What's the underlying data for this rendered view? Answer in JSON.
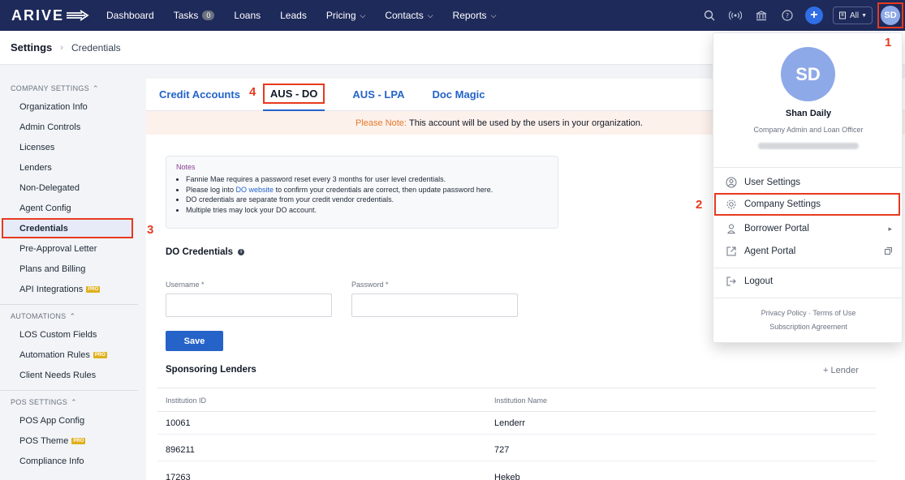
{
  "app": {
    "logo": "ARIVE"
  },
  "nav": {
    "items": [
      {
        "label": "Dashboard"
      },
      {
        "label": "Tasks",
        "badge": "0"
      },
      {
        "label": "Loans"
      },
      {
        "label": "Leads"
      },
      {
        "label": "Pricing",
        "chevron": true
      },
      {
        "label": "Contacts",
        "chevron": true
      },
      {
        "label": "Reports",
        "chevron": true
      }
    ],
    "all_label": "All",
    "avatar_initials": "SD"
  },
  "breadcrumb": {
    "root": "Settings",
    "current": "Credentials"
  },
  "sidebar": {
    "groups": [
      {
        "title": "COMPANY SETTINGS",
        "items": [
          "Organization Info",
          "Admin Controls",
          "Licenses",
          "Lenders",
          "Non-Delegated",
          "Agent Config",
          "Credentials",
          "Pre-Approval Letter",
          "Plans and Billing",
          "API Integrations"
        ]
      },
      {
        "title": "AUTOMATIONS",
        "items": [
          "LOS Custom Fields",
          "Automation Rules",
          "Client Needs Rules"
        ]
      },
      {
        "title": "POS SETTINGS",
        "items": [
          "POS App Config",
          "POS Theme",
          "Compliance Info"
        ]
      }
    ],
    "pro_label": "PRO",
    "active_item": "Credentials"
  },
  "tabs": [
    "Credit Accounts",
    "AUS - DO",
    "AUS - LPA",
    "Doc Magic"
  ],
  "active_tab": "AUS - DO",
  "please_note": {
    "label": "Please Note:",
    "text": "This account will be used by the users in your organization."
  },
  "notes": {
    "title": "Notes",
    "items": [
      {
        "text": "Fannie Mae requires a password reset every 3 months for user level credentials."
      },
      {
        "pre": "Please log into ",
        "link": "DO website",
        "post": " to confirm your credentials are correct, then update password here."
      },
      {
        "text": "DO credentials are separate from your credit vendor credentials."
      },
      {
        "text": "Multiple tries may lock your DO account."
      }
    ]
  },
  "do_credentials": {
    "title": "DO Credentials",
    "username_label": "Username *",
    "password_label": "Password *",
    "username_value": "",
    "password_value": "",
    "save_label": "Save"
  },
  "sponsoring_lenders": {
    "title": "Sponsoring Lenders",
    "add_label": "+ Lender",
    "columns": [
      "Institution ID",
      "Institution Name"
    ],
    "rows": [
      [
        "10061",
        "Lenderr"
      ],
      [
        "896211",
        "727"
      ],
      [
        "17263",
        "Hekeb"
      ]
    ]
  },
  "user_menu": {
    "initials": "SD",
    "name": "Shan Daily",
    "role": "Company Admin and Loan Officer",
    "items": [
      "User Settings",
      "Company Settings",
      "Borrower Portal",
      "Agent Portal",
      "Logout"
    ],
    "footer_line1": "Privacy Policy · Terms of Use",
    "footer_line2": "Subscription Agreement"
  },
  "annotations": [
    "1",
    "2",
    "3",
    "4"
  ],
  "colors": {
    "nav_bg": "#1e2a5a",
    "accent": "#2563c9",
    "highlight": "#e8391f"
  }
}
